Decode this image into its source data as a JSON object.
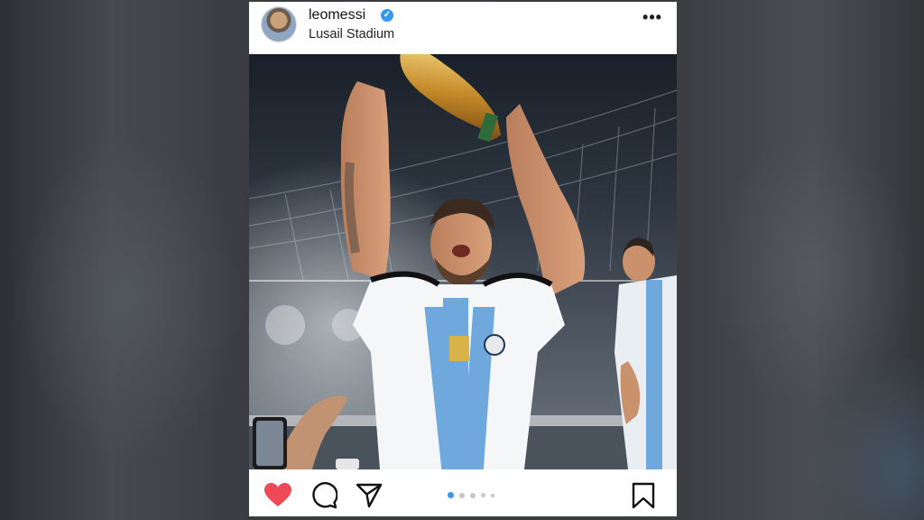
{
  "post": {
    "username": "leomessi",
    "location": "Lusail Stadium",
    "verified_glyph": "✓",
    "more_glyph": "•••",
    "avatar_icon": "profile-avatar",
    "actions": {
      "like_icon": "heart-icon",
      "like_color": "#ed4956",
      "comment_icon": "comment-icon",
      "share_icon": "share-icon",
      "save_icon": "bookmark-icon"
    },
    "carousel": {
      "total": 5,
      "active_index": 0,
      "active_color": "#3897f0",
      "inactive_color": "#c7c7c7"
    }
  }
}
